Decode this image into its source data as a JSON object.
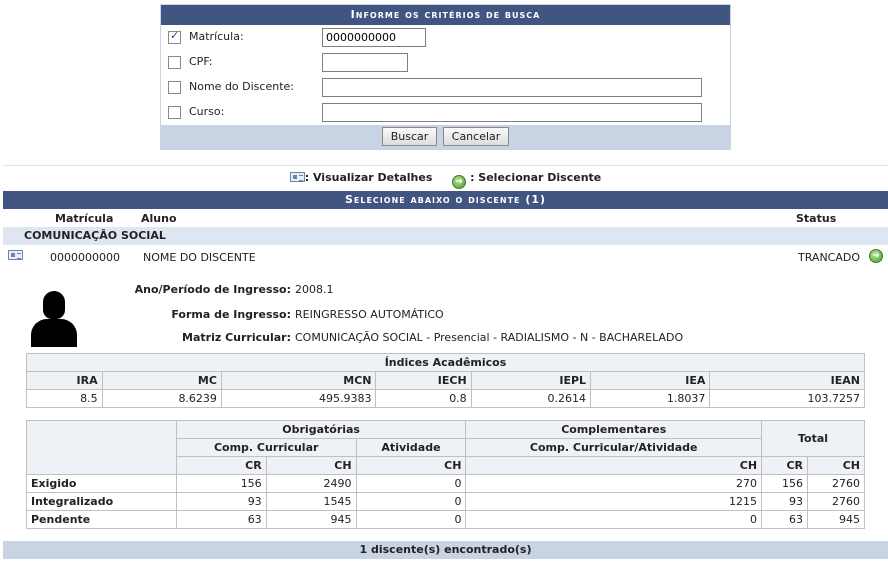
{
  "search": {
    "title": "Informe os critérios de busca",
    "fields": [
      {
        "label": "Matrícula:",
        "checked": true,
        "value": "0000000000"
      },
      {
        "label": "CPF:",
        "checked": false,
        "value": ""
      },
      {
        "label": "Nome do Discente:",
        "checked": false,
        "value": ""
      },
      {
        "label": "Curso:",
        "checked": false,
        "value": ""
      }
    ],
    "buttons": {
      "search": "Buscar",
      "cancel": "Cancelar"
    }
  },
  "legend": {
    "details": ": Visualizar Detalhes",
    "select": ": Selecionar Discente"
  },
  "results": {
    "title": "Selecione abaixo o discente (1)",
    "headers": {
      "matricula": "Matrícula",
      "aluno": "Aluno",
      "status": "Status"
    },
    "course": "COMUNICAÇÃO SOCIAL",
    "student": {
      "matricula": "0000000000",
      "name": "NOME DO DISCENTE",
      "status": "TRANCADO"
    },
    "details": {
      "ingresso_label": "Ano/Período de Ingresso:",
      "ingresso_value": "2008.1",
      "forma_label": "Forma de Ingresso:",
      "forma_value": "REINGRESSO AUTOMÁTICO",
      "matriz_label": "Matriz Curricular:",
      "matriz_value": "COMUNICAÇÃO SOCIAL - Presencial - RADIALISMO - N - BACHARELADO"
    },
    "indices": {
      "title": "Índices Acadêmicos",
      "columns": [
        "IRA",
        "MC",
        "MCN",
        "IECH",
        "IEPL",
        "IEA",
        "IEAN"
      ],
      "values": [
        "8.5",
        "8.6239",
        "495.9383",
        "0.8",
        "0.2614",
        "1.8037",
        "103.7257"
      ]
    },
    "workload": {
      "obrigatorias": "Obrigatórias",
      "complementares": "Complementares",
      "total": "Total",
      "comp_curricular": "Comp. Curricular",
      "atividade": "Atividade",
      "comp_curricular_atividade": "Comp. Curricular/Atividade",
      "cr": "CR",
      "ch": "CH",
      "rows": [
        {
          "label": "Exigido",
          "cr": "156",
          "ch": "2490",
          "ativ_ch": "0",
          "comp_ch": "270",
          "tot_cr": "156",
          "tot_ch": "2760"
        },
        {
          "label": "Integralizado",
          "cr": "93",
          "ch": "1545",
          "ativ_ch": "0",
          "comp_ch": "1215",
          "tot_cr": "93",
          "tot_ch": "2760"
        },
        {
          "label": "Pendente",
          "cr": "63",
          "ch": "945",
          "ativ_ch": "0",
          "comp_ch": "0",
          "tot_cr": "63",
          "tot_ch": "945"
        }
      ]
    },
    "footer": "1 discente(s) encontrado(s)"
  }
}
